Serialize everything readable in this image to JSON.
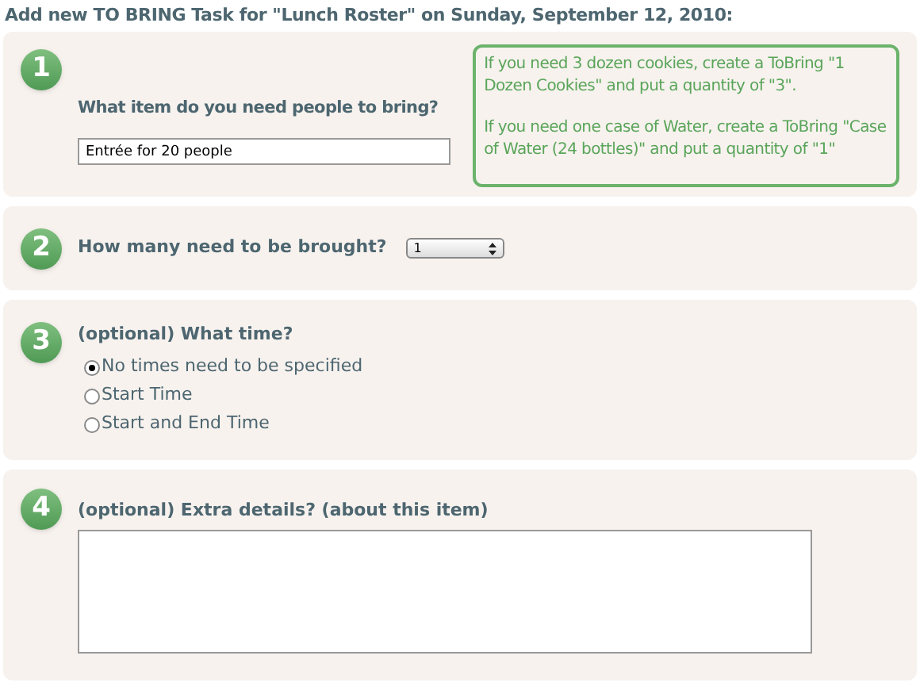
{
  "heading": "Add new TO BRING Task for \"Lunch Roster\" on Sunday, September 12, 2010:",
  "step1": {
    "number": "1",
    "label": "What item do you need people to bring?",
    "value": "Entrée for 20 people",
    "tips": [
      "If you need 3 dozen cookies, create a ToBring \"1 Dozen Cookies\" and put a quantity of \"3\".",
      "If you need one case of Water, create a ToBring \"Case of Water (24 bottles)\" and put a quantity of \"1\""
    ]
  },
  "step2": {
    "number": "2",
    "label": "How many need to be brought?",
    "value": "1"
  },
  "step3": {
    "number": "3",
    "label": "(optional) What time?",
    "options": [
      {
        "label": "No times need to be specified",
        "selected": true
      },
      {
        "label": "Start Time",
        "selected": false
      },
      {
        "label": "Start and End Time",
        "selected": false
      }
    ]
  },
  "step4": {
    "number": "4",
    "label": "(optional) Extra details? (about this item)"
  }
}
